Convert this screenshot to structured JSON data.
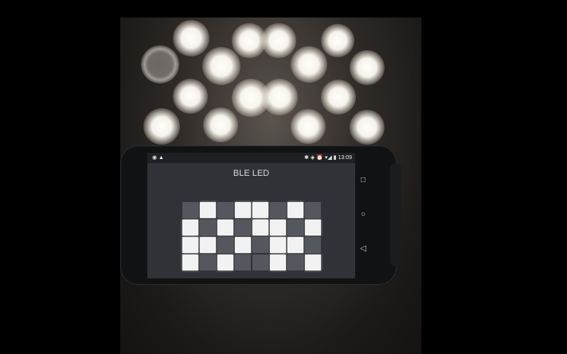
{
  "status_bar": {
    "left_icons": [
      "whatsapp-icon",
      "warning-icon"
    ],
    "right_icons": [
      "bluetooth-icon",
      "vibrate-icon",
      "alarm-icon",
      "wifi-icon",
      "signal-icon",
      "battery-icon"
    ],
    "left_glyphs": "◉ ▲",
    "right_glyphs": "✱ ◈ ⏰ ▾◢ ▮",
    "time": "13:09"
  },
  "app": {
    "title": "BLE LED"
  },
  "led_grid": {
    "rows": 4,
    "cols": 8,
    "states": [
      [
        0,
        1,
        0,
        1,
        1,
        0,
        1,
        0
      ],
      [
        1,
        0,
        1,
        0,
        1,
        1,
        0,
        1
      ],
      [
        1,
        1,
        0,
        1,
        0,
        1,
        1,
        0
      ],
      [
        1,
        0,
        1,
        0,
        0,
        1,
        0,
        1
      ]
    ],
    "on_color": "#f2f2f2",
    "off_color": "#55575e"
  },
  "nav": {
    "recents_glyph": "□",
    "home_glyph": "○",
    "back_glyph": "◁"
  }
}
